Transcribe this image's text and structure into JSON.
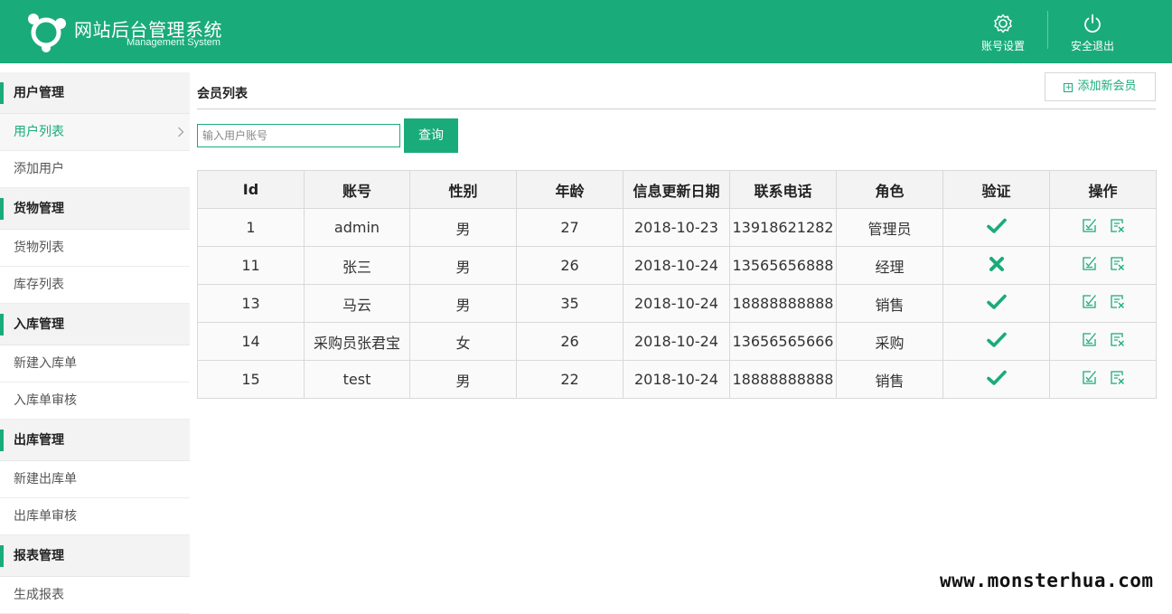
{
  "header": {
    "brand_cn": "网站后台管理系统",
    "brand_en": "Management System",
    "account_settings": "账号设置",
    "logout": "安全退出",
    "accent": "#1aab7b"
  },
  "sidebar": {
    "groups": [
      {
        "title": "用户管理",
        "items": [
          "用户列表",
          "添加用户"
        ]
      },
      {
        "title": "货物管理",
        "items": [
          "货物列表",
          "库存列表"
        ]
      },
      {
        "title": "入库管理",
        "items": [
          "新建入库单",
          "入库单审核"
        ]
      },
      {
        "title": "出库管理",
        "items": [
          "新建出库单",
          "出库单审核"
        ]
      },
      {
        "title": "报表管理",
        "items": [
          "生成报表"
        ]
      }
    ],
    "active_item": "用户列表"
  },
  "main": {
    "title": "会员列表",
    "add_button": "添加新会员",
    "search_placeholder": "输入用户账号",
    "search_button": "查询"
  },
  "table": {
    "headers": [
      "Id",
      "账号",
      "性别",
      "年龄",
      "信息更新日期",
      "联系电话",
      "角色",
      "验证",
      "操作"
    ],
    "rows": [
      {
        "id": "1",
        "account": "admin",
        "gender": "男",
        "age": "27",
        "date": "2018-10-23",
        "phone": "13918621282",
        "role": "管理员",
        "verified": true
      },
      {
        "id": "11",
        "account": "张三",
        "gender": "男",
        "age": "26",
        "date": "2018-10-24",
        "phone": "13565656888",
        "role": "经理",
        "verified": false
      },
      {
        "id": "13",
        "account": "马云",
        "gender": "男",
        "age": "35",
        "date": "2018-10-24",
        "phone": "18888888888",
        "role": "销售",
        "verified": true
      },
      {
        "id": "14",
        "account": "采购员张君宝",
        "gender": "女",
        "age": "26",
        "date": "2018-10-24",
        "phone": "13656565666",
        "role": "采购",
        "verified": true
      },
      {
        "id": "15",
        "account": "test",
        "gender": "男",
        "age": "22",
        "date": "2018-10-24",
        "phone": "18888888888",
        "role": "销售",
        "verified": true
      }
    ],
    "row_action_icons": [
      "edit-icon",
      "delete-icon"
    ]
  },
  "watermark": "www.monsterhua.com"
}
